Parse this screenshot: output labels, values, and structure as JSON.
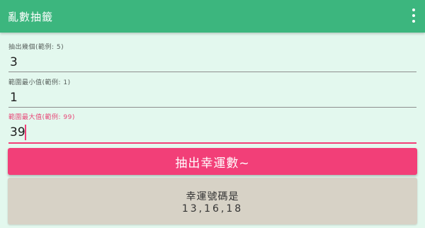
{
  "app": {
    "title": "亂數抽籤"
  },
  "form": {
    "count": {
      "label": "抽出幾個(範例: 5)",
      "value": "3"
    },
    "min": {
      "label": "範圍最小值(範例: 1)",
      "value": "1"
    },
    "max": {
      "label": "範圍最大值(範例: 99)",
      "value": "39"
    }
  },
  "draw_button": {
    "label": "抽出幸運數~"
  },
  "result": {
    "label": "幸運號碼是",
    "numbers": "13,16,18"
  },
  "icons": {
    "menu": "more-vert-icon"
  },
  "colors": {
    "appbar": "#3cb67e",
    "background": "#e3f8ee",
    "accent": "#f23f78",
    "result_background": "#d7d2c6"
  }
}
